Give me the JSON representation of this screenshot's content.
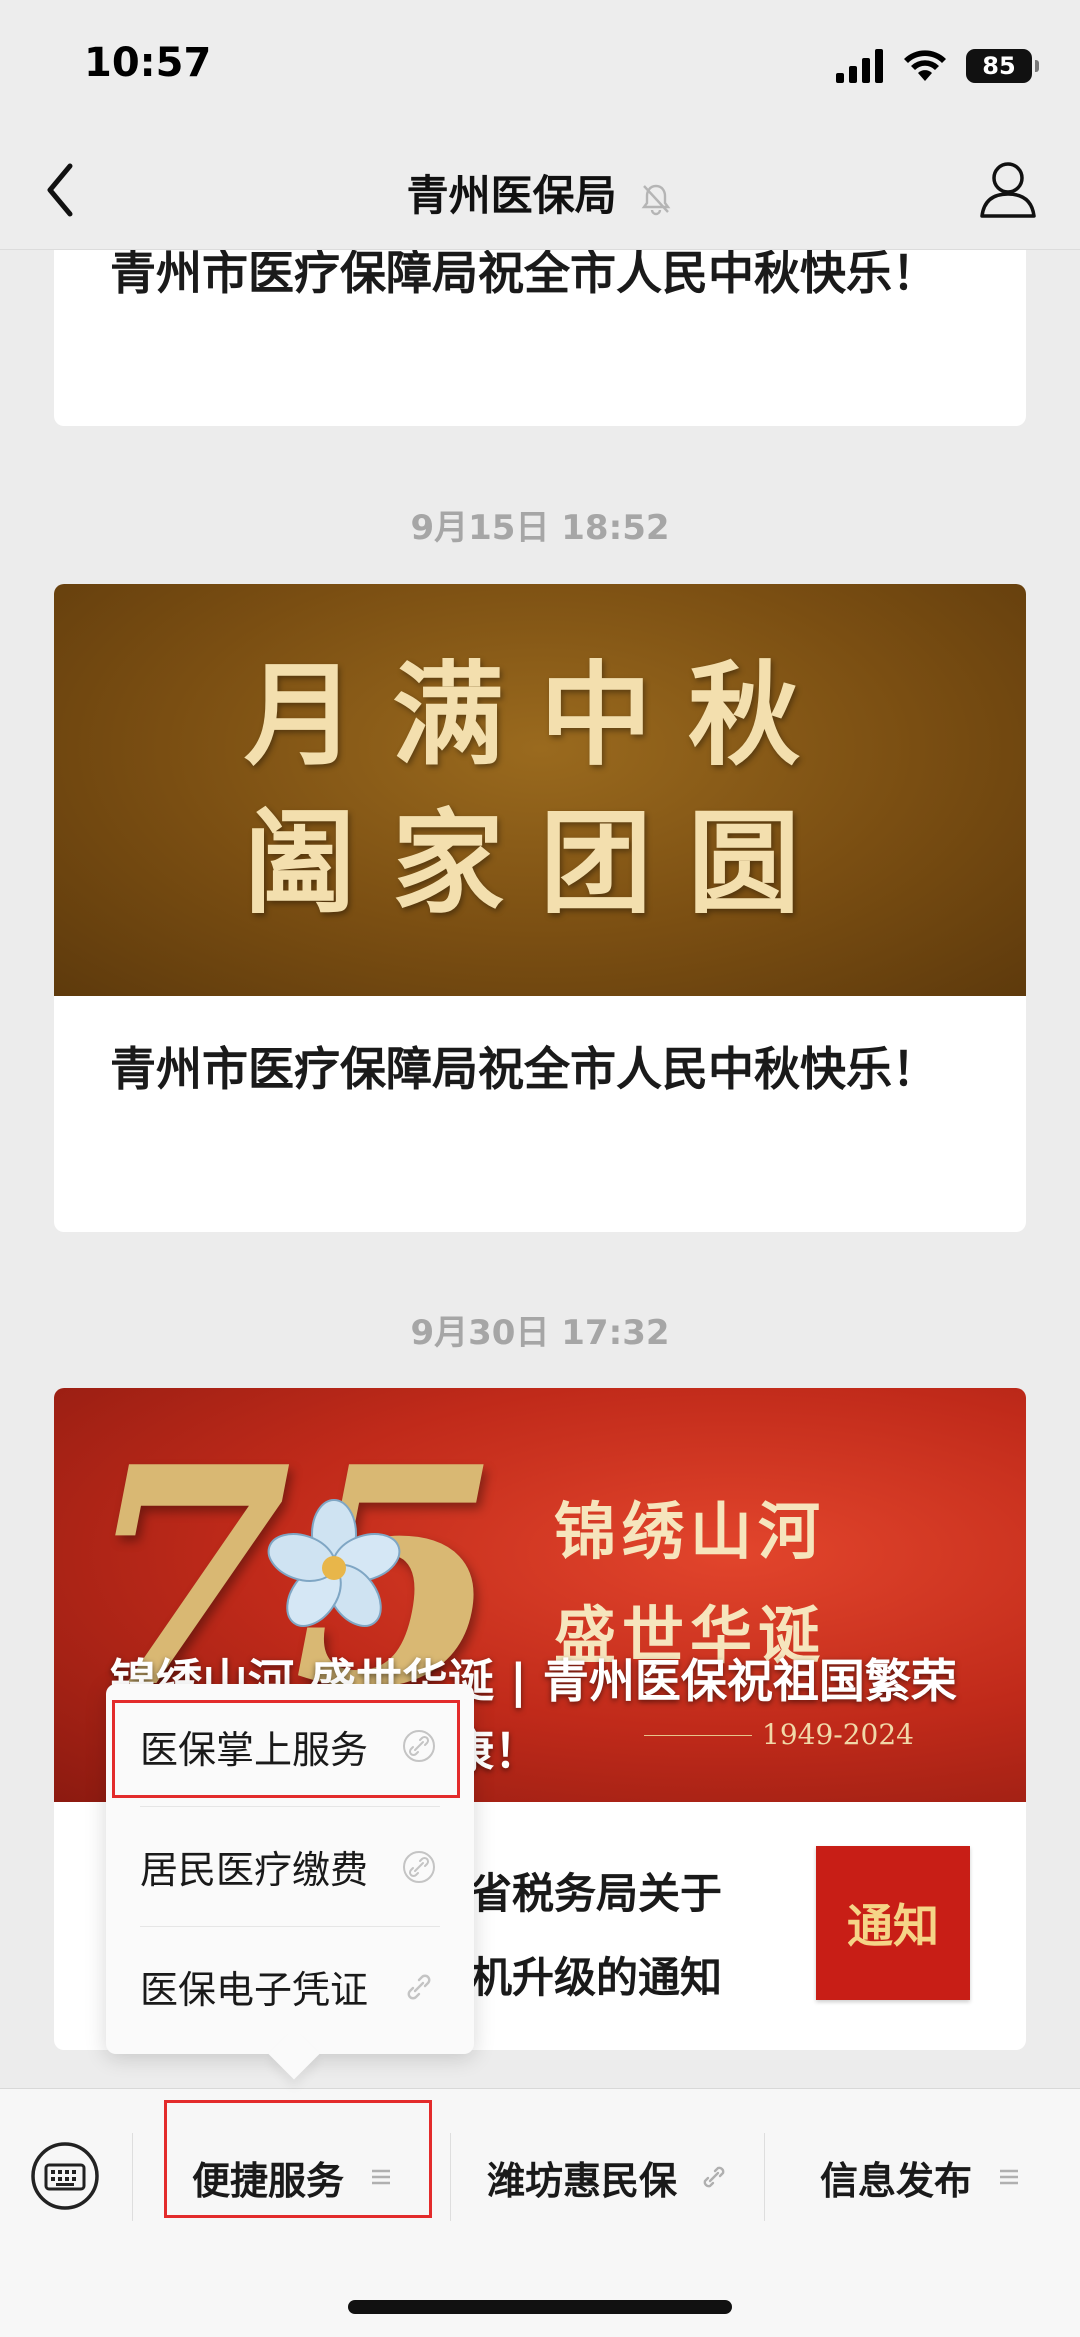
{
  "status_bar": {
    "time": "10:57",
    "battery": "85"
  },
  "nav": {
    "title": "青州医保局"
  },
  "feed": [
    {
      "title": "青州市医疗保障局祝全市人民中秋快乐！"
    },
    {
      "timestamp": "9月15日 18:52",
      "banner_lines": [
        "月满中秋",
        "阖家团圆"
      ],
      "title": "青州市医疗保障局祝全市人民中秋快乐！"
    },
    {
      "timestamp": "9月30日 17:32",
      "banner_number": "75",
      "banner_slogan_lines": [
        "锦绣山河",
        "盛世华诞"
      ],
      "banner_years": "1949-2024",
      "title": "锦绣山河 盛世华诞 | 青州医保祝祖国繁荣昌盛 人民幸福安康！",
      "sub_article_title": "潍坊市医疗保障局 国家税务总局山东省税务局关于城乡居民医保缴费系统上线试运行升级的通知",
      "sub_article_title_visible": "省税务局关于机升级的通知",
      "sub_thumb_text": "通知"
    }
  ],
  "submenu": {
    "items": [
      {
        "label": "医保掌上服务",
        "icon": "link-icon"
      },
      {
        "label": "居民医疗缴费",
        "icon": "link-icon"
      },
      {
        "label": "医保电子凭证",
        "icon": "link-icon"
      }
    ]
  },
  "bottom_menu": {
    "tabs": [
      {
        "label": "便捷服务",
        "icon": "menu-lines-icon"
      },
      {
        "label": "潍坊惠民保",
        "icon": "link-icon"
      },
      {
        "label": "信息发布",
        "icon": "menu-lines-icon"
      }
    ]
  },
  "colors": {
    "highlight": "#e32b2b",
    "gold_banner": "#7a4e12",
    "red_banner": "#c02a1a"
  }
}
